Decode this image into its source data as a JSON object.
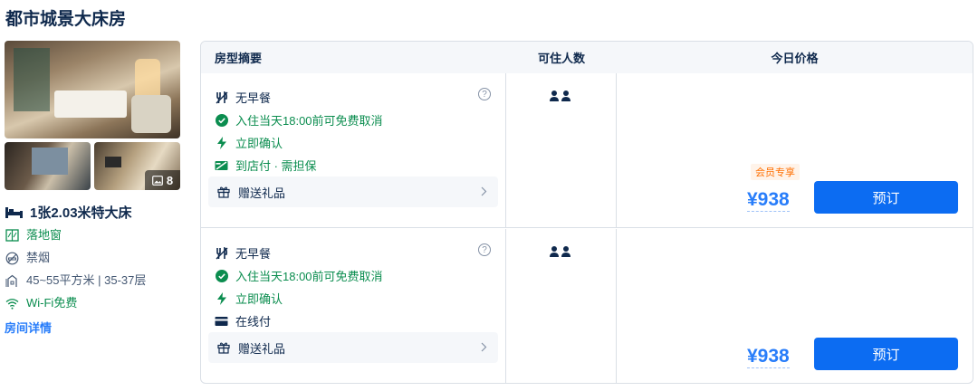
{
  "room": {
    "title": "都市城景大床房",
    "photo_count": "8",
    "bed": "1张2.03米特大床",
    "features": [
      {
        "icon": "window-icon",
        "label": "落地窗"
      },
      {
        "icon": "no-smoking-icon",
        "label": "禁烟"
      },
      {
        "icon": "area-icon",
        "label": "45~55平方米 | 35-37层"
      },
      {
        "icon": "wifi-icon",
        "label": "Wi-Fi免费"
      }
    ],
    "details_link": "房间详情"
  },
  "table": {
    "headers": [
      "房型摘要",
      "可住人数",
      "今日价格"
    ],
    "rows": [
      {
        "policies": [
          "无早餐",
          "入住当天18:00前可免费取消",
          "立即确认",
          "到店付 · 需担保"
        ],
        "gift": "赠送礼品",
        "member_badge": "会员专享",
        "price": "¥938",
        "book": "预订"
      },
      {
        "policies": [
          "无早餐",
          "入住当天18:00前可免费取消",
          "立即确认",
          "在线付"
        ],
        "gift": "赠送礼品",
        "price": "¥938",
        "book": "预订"
      }
    ]
  },
  "colors": {
    "accent": "#0c6cf2",
    "price": "#287dfa",
    "green": "#0b8d4f",
    "member": "#ff6f00"
  }
}
